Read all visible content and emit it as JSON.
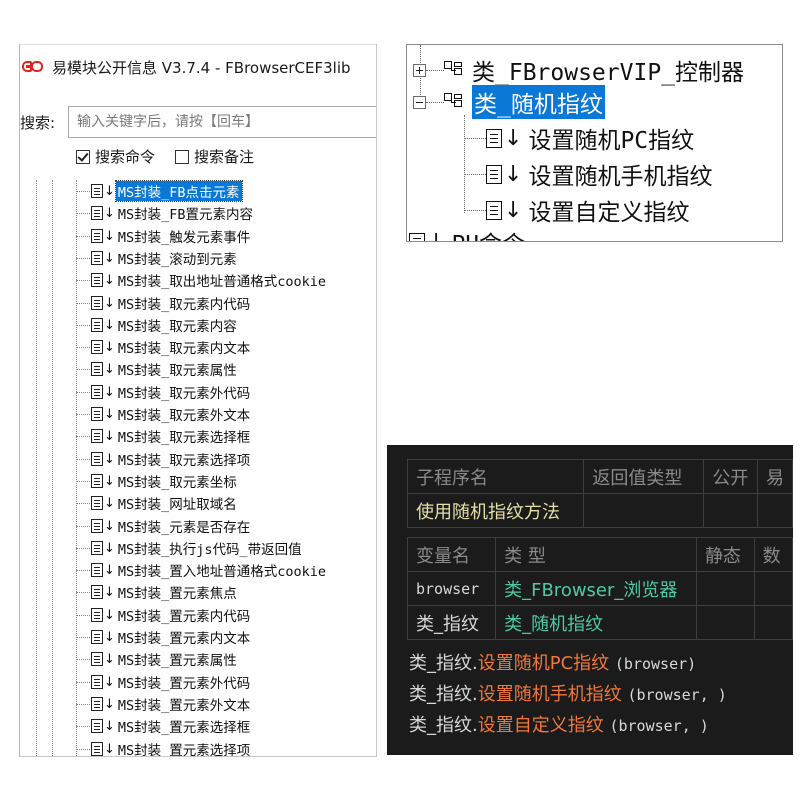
{
  "left_panel": {
    "title": "易模块公开信息 V3.7.4 - FBrowserCEF3lib",
    "search_label": "搜索:",
    "search_placeholder": "输入关键字后，请按【回车】",
    "options": [
      {
        "label": "搜索命令",
        "checked": true
      },
      {
        "label": "搜索备注",
        "checked": false
      }
    ],
    "tree_items": [
      "MS封装_FB点击元素",
      "MS封装_FB置元素内容",
      "MS封装_触发元素事件",
      "MS封装_滚动到元素",
      "MS封装_取出地址普通格式cookie",
      "MS封装_取元素内代码",
      "MS封装_取元素内容",
      "MS封装_取元素内文本",
      "MS封装_取元素属性",
      "MS封装_取元素外代码",
      "MS封装_取元素外文本",
      "MS封装_取元素选择框",
      "MS封装_取元素选择项",
      "MS封装_取元素坐标",
      "MS封装_网址取域名",
      "MS封装_元素是否存在",
      "MS封装_执行js代码_带返回值",
      "MS封装_置入地址普通格式cookie",
      "MS封装_置元素焦点",
      "MS封装_置元素内代码",
      "MS封装_置元素内文本",
      "MS封装_置元素属性",
      "MS封装_置元素外代码",
      "MS封装_置元素外文本",
      "MS封装_置元素选择框",
      "MS封装_置元素选择项"
    ],
    "selected_index": 0
  },
  "class_panel": {
    "classes": [
      {
        "label": "类_FBrowserVIP_控制器",
        "expanded": false,
        "selected": false
      },
      {
        "label": "类_随机指纹",
        "expanded": true,
        "selected": true
      }
    ],
    "methods": [
      "设置随机PC指纹",
      "设置随机手机指纹",
      "设置自定义指纹"
    ],
    "cut_off_text": "PU命令"
  },
  "code_panel": {
    "sub_header": [
      "子程序名",
      "返回值类型",
      "公开",
      "易"
    ],
    "sub_name": "使用随机指纹方法",
    "var_header": [
      "变量名",
      "类 型",
      "静态",
      "数"
    ],
    "vars": [
      {
        "name": "browser",
        "type": "类_FBrowser_浏览器"
      },
      {
        "name": "类_指纹",
        "type": "类_随机指纹"
      }
    ],
    "code_lines": [
      {
        "object": "类_指纹.",
        "method": "设置随机PC指纹",
        "args": "(browser)"
      },
      {
        "object": "类_指纹.",
        "method": "设置随机手机指纹",
        "args": "(browser, )"
      },
      {
        "object": "类_指纹.",
        "method": "设置自定义指纹",
        "args": "(browser, )"
      }
    ],
    "colors": {
      "background": "#1b1b1b",
      "type_color": "#4ec9a6",
      "method_color": "#f0783c",
      "name_color": "#e6dfa6"
    }
  }
}
